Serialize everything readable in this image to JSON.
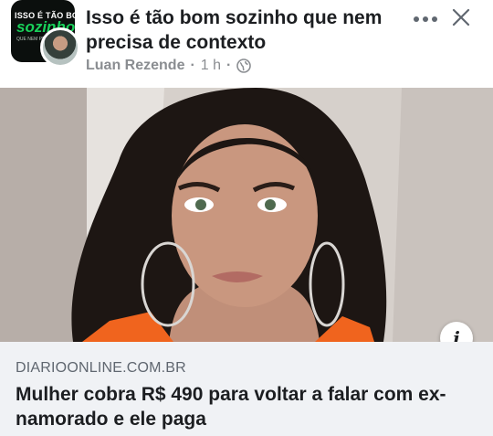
{
  "post": {
    "group_avatar": {
      "line1": "ISSO É TÃO BOM",
      "line2": "sozinho",
      "line3": "QUE NEM PRECISA"
    },
    "title": "Isso é tão bom sozinho que nem precisa de contexto",
    "author": "Luan Rezende",
    "separator": "·",
    "time": "1 h",
    "privacy_icon": "globe-icon",
    "more_icon": "more-options-icon",
    "close_icon": "close-icon"
  },
  "link_preview": {
    "info_icon": "info-icon",
    "info_glyph": "i",
    "domain": "DIARIOONLINE.COM.BR",
    "headline": "Mulher cobra R$ 490 para voltar a falar com ex-namorado e ele paga"
  },
  "colors": {
    "text_primary": "#1c1e21",
    "text_secondary": "#8a8d91",
    "card_background": "#f0f2f5",
    "brand_green": "#19d15a"
  }
}
